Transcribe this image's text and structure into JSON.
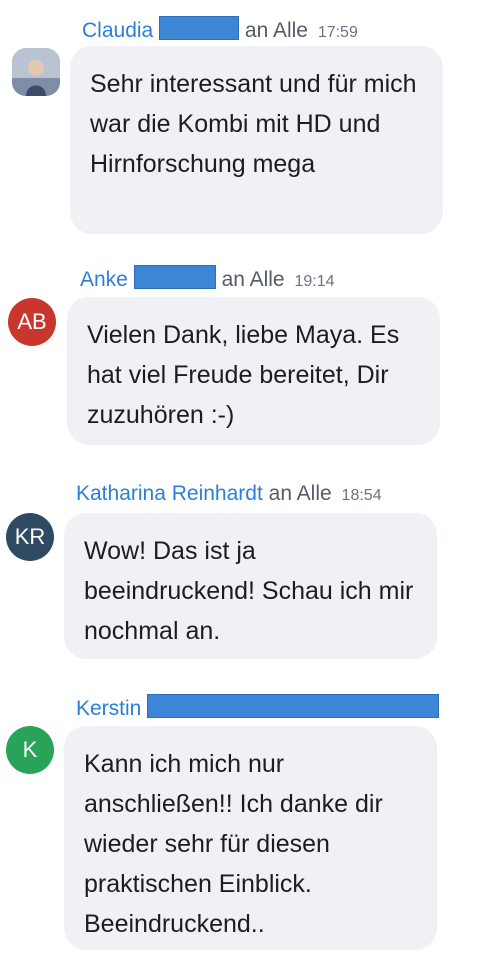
{
  "messages": [
    {
      "sender_first": "Claudia",
      "to_label": "an Alle",
      "time": "17:59",
      "avatar_type": "photo",
      "text": "Sehr interessant und für mich war die Kombi mit HD und Hirnforschung mega"
    },
    {
      "sender_first": "Anke",
      "to_label": "an Alle",
      "time": "19:14",
      "avatar_type": "initials",
      "initials": "AB",
      "avatar_color": "#c9372c",
      "text": "Vielen Dank, liebe Maya. Es hat viel Freude bereitet, Dir zuzuhören :-)"
    },
    {
      "sender_first": "Katharina Reinhardt",
      "to_label": "an Alle",
      "time": "18:54",
      "avatar_type": "initials",
      "initials": "KR",
      "avatar_color": "#2f4a63",
      "text": "Wow! Das ist ja beeindruckend! Schau ich mir nochmal an."
    },
    {
      "sender_first": "Kerstin",
      "avatar_type": "initials",
      "initials": "K",
      "avatar_color": "#2aa35a",
      "text": "Kann ich mich nur anschließen!! Ich danke dir wieder sehr für diesen praktischen Einblick. Beeindruckend.."
    }
  ],
  "colors": {
    "name_blue": "#2b7fd9",
    "bubble_bg": "#f0f1f5",
    "redaction": "#3d86d6"
  }
}
